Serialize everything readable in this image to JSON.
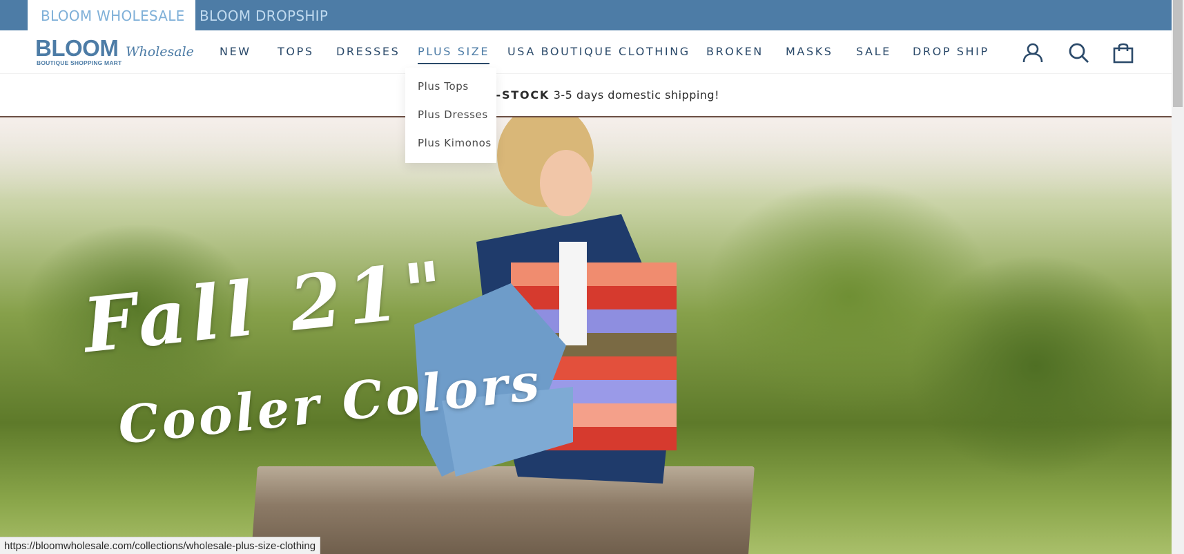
{
  "store_bar": {
    "active_label": "BLOOM WHOLESALE",
    "inactive_label": "BLOOM DROPSHIP",
    "color": "#4d7ca6"
  },
  "logo": {
    "main": "BLOOM",
    "script": "Wholesale",
    "tagline": "BOUTIQUE SHOPPING MART"
  },
  "nav": {
    "items": [
      {
        "label": "NEW"
      },
      {
        "label": "TOPS"
      },
      {
        "label": "DRESSES"
      },
      {
        "label": "PLUS SIZE"
      },
      {
        "label": "USA BOUTIQUE CLOTHING"
      },
      {
        "label": "BROKEN"
      },
      {
        "label": "MASKS"
      },
      {
        "label": "SALE"
      },
      {
        "label": "DROP SHIP"
      }
    ],
    "active_index": 3
  },
  "header_icons": {
    "account": "account-icon",
    "search": "search-icon",
    "cart": "cart-icon"
  },
  "announcement": {
    "bold_part": "ITE IN-STOCK",
    "rest": " 3-5 days domestic shipping!"
  },
  "dropdown": {
    "items": [
      {
        "label": "Plus Tops"
      },
      {
        "label": "Plus Dresses"
      },
      {
        "label": "Plus Kimonos"
      }
    ]
  },
  "hero": {
    "title_line_1": "Fall 21\"",
    "title_line_2": "Cooler Colors"
  },
  "status_bar": {
    "url": "https://bloomwholesale.com/collections/wholesale-plus-size-clothing"
  }
}
